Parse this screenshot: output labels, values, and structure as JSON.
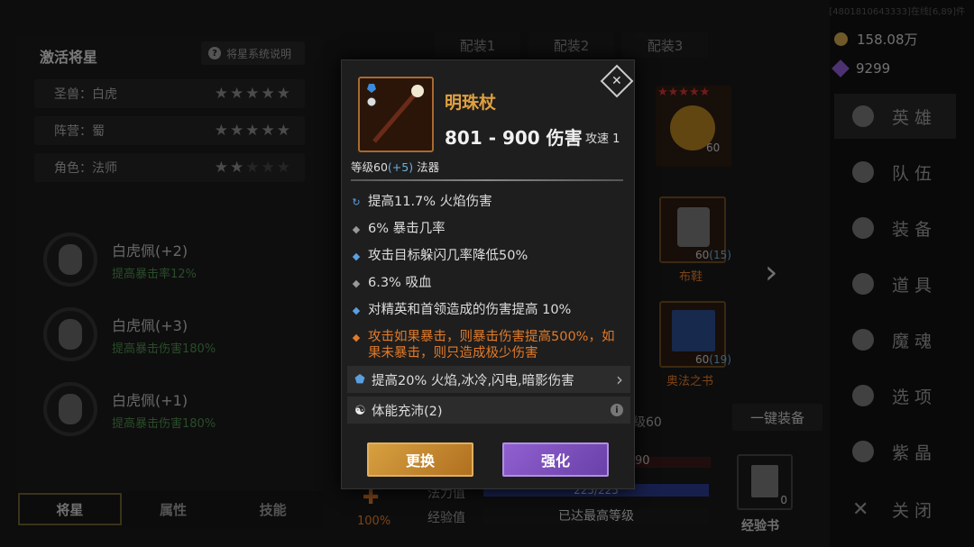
{
  "left": {
    "title": "激活将星",
    "help": "将星系统说明",
    "rows": [
      {
        "label": "圣兽：白虎",
        "stars": 5
      },
      {
        "label": "阵营：蜀",
        "stars": 5
      },
      {
        "label": "角色：法师",
        "stars": 2
      }
    ],
    "bonuses": [
      {
        "name": "白虎佩(+2)",
        "desc": "提高暴击率12%"
      },
      {
        "name": "白虎佩(+3)",
        "desc": "提高暴击伤害180%"
      },
      {
        "name": "白虎佩(+1)",
        "desc": "提高暴击伤害180%"
      }
    ],
    "tabs": [
      "将星",
      "属性",
      "技能"
    ]
  },
  "loadouts": [
    "配装1",
    "配装2",
    "配装3"
  ],
  "resources": {
    "gold": "158.08万",
    "gems": "9299"
  },
  "uid": "[4801810643333]在线[6,89]件",
  "menu": [
    "英雄",
    "队伍",
    "装备",
    "道具",
    "魔魂",
    "选项",
    "紫晶",
    "关闭"
  ],
  "background": {
    "hero_level": "60",
    "boots_level": "60",
    "boots_plus": "(15)",
    "boots_name": "布鞋",
    "book_level": "60",
    "book_plus": "(19)",
    "book_name": "奥法之书",
    "level_text": "级60",
    "one_key": "一键装备",
    "mana_label": "法力值",
    "mana_value": "225/225",
    "exp_label": "经验值",
    "exp_value": "已达最高等级",
    "hp_value": "90",
    "percent": "100%",
    "exp_book": "经验书",
    "exp_book_count": "0"
  },
  "item": {
    "name": "明珠杖",
    "damage": "801 - 900 伤害",
    "speed": "攻速 1",
    "level_prefix": "等级60",
    "level_plus": "(+5)",
    "type": "法器",
    "stats": [
      {
        "text": "提高11.7% 火焰伤害",
        "bullet": "refresh",
        "color": "normal"
      },
      {
        "text": "6% 暴击几率",
        "bullet": "grey",
        "color": "normal"
      },
      {
        "text": "攻击目标躲闪几率降低50%",
        "bullet": "blue",
        "color": "normal"
      },
      {
        "text": "6.3% 吸血",
        "bullet": "grey",
        "color": "normal"
      },
      {
        "text": "对精英和首领造成的伤害提高 10%",
        "bullet": "blue",
        "color": "normal"
      },
      {
        "text": "攻击如果暴击，则暴击伤害提高500%，如果未暴击，则只造成极少伤害",
        "bullet": "orange",
        "color": "orange"
      }
    ],
    "gem_stat": "提高20% 火焰,冰冷,闪电,暗影伤害",
    "set_stat": "体能充沛(2)",
    "swap": "更换",
    "upgrade": "强化"
  },
  "colors": {
    "item_name": "#e0a040",
    "legendary": "#e07a2a",
    "bonus": "#4a8a4a",
    "gold": "#c9a24a",
    "purple": "#8a5acc"
  }
}
